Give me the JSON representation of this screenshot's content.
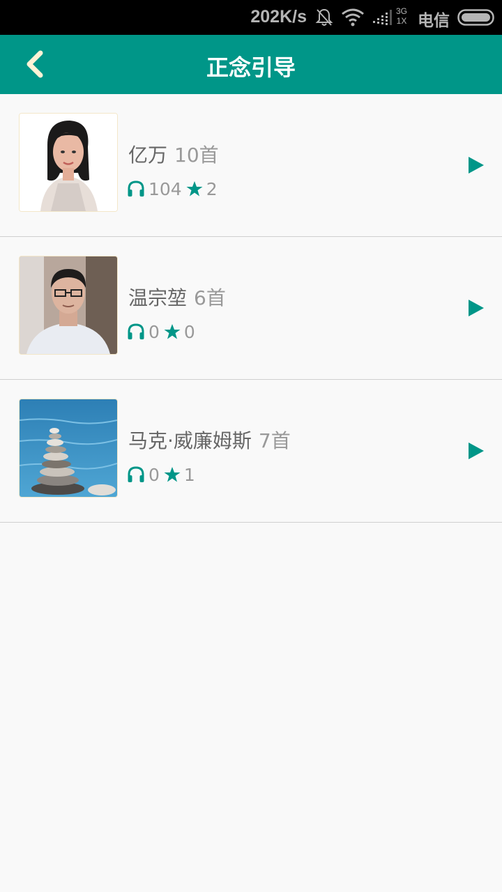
{
  "status_bar": {
    "speed": "202K/s",
    "network_top": "3G",
    "network_bottom": "1X",
    "carrier": "电信",
    "icons": [
      "bell-off-icon",
      "wifi-icon",
      "signal-icon",
      "battery-icon"
    ]
  },
  "app_bar": {
    "title": "正念引导",
    "back_icon": "chevron-left-icon",
    "background": "#009688"
  },
  "guides": [
    {
      "name": "亿万",
      "count": "10首",
      "listens": "104",
      "favorites": "2",
      "avatar": "woman-portrait"
    },
    {
      "name": "温宗堃",
      "count": "6首",
      "listens": "0",
      "favorites": "0",
      "avatar": "man-portrait"
    },
    {
      "name": "马克·威廉姆斯",
      "count": "7首",
      "listens": "0",
      "favorites": "1",
      "avatar": "stacked-stones"
    }
  ],
  "colors": {
    "accent": "#009688",
    "text": "#666666",
    "muted": "#999999"
  }
}
